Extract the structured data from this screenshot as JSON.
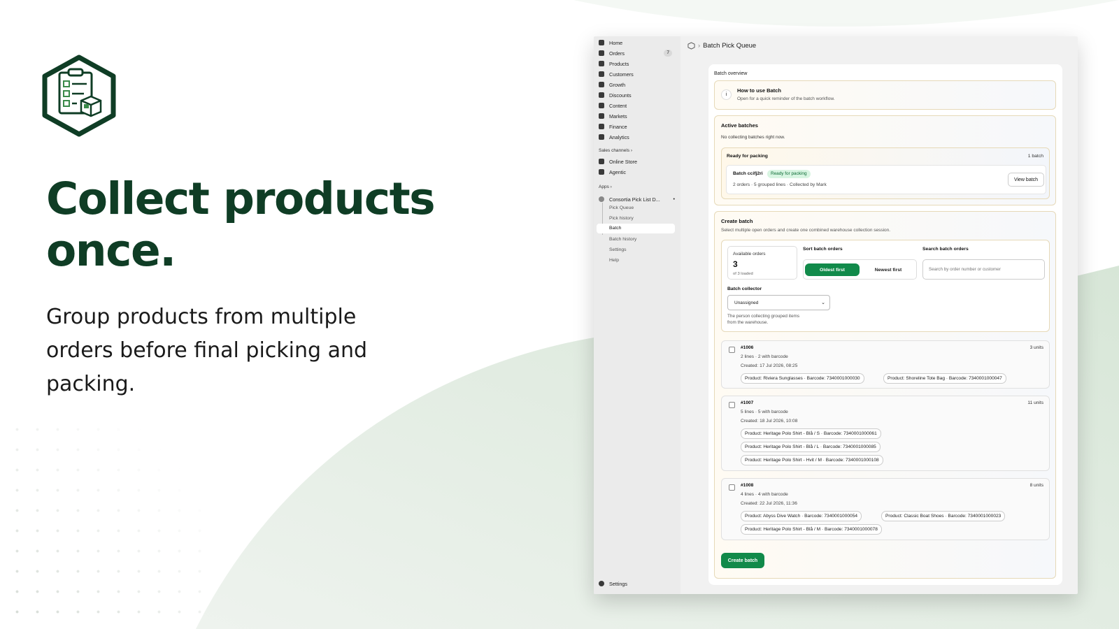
{
  "hero": {
    "title_line1": "Collect products",
    "title_line2": "once.",
    "subtitle_line1": "Group products from multiple",
    "subtitle_line2": "orders before final picking and",
    "subtitle_line3": "packing."
  },
  "colors": {
    "brand": "#0f3d25",
    "accent": "#118a4a"
  },
  "sidebar": {
    "items": [
      {
        "label": "Home",
        "icon": "home-icon"
      },
      {
        "label": "Orders",
        "icon": "orders-icon",
        "badge": "7"
      },
      {
        "label": "Products",
        "icon": "tag-icon"
      },
      {
        "label": "Customers",
        "icon": "person-icon"
      },
      {
        "label": "Growth",
        "icon": "growth-icon"
      },
      {
        "label": "Discounts",
        "icon": "discount-icon"
      },
      {
        "label": "Content",
        "icon": "content-icon"
      },
      {
        "label": "Markets",
        "icon": "globe-icon"
      },
      {
        "label": "Finance",
        "icon": "bank-icon"
      },
      {
        "label": "Analytics",
        "icon": "chart-icon"
      }
    ],
    "sales_channels_label": "Sales channels",
    "channels": [
      {
        "label": "Online Store",
        "icon": "store-icon"
      },
      {
        "label": "Agentic",
        "icon": "agentic-icon"
      }
    ],
    "apps_label": "Apps",
    "app_name": "Consortia Pick List D...",
    "app_items": [
      "Pick Queue",
      "Pick history",
      "Batch",
      "Batch history",
      "Settings",
      "Help"
    ],
    "settings_label": "Settings"
  },
  "topbar": {
    "title": "Batch Pick Queue"
  },
  "main": {
    "section_label": "Batch overview",
    "info_title": "How to use Batch",
    "info_text": "Open for a quick reminder of the batch workflow.",
    "active": {
      "title": "Active batches",
      "empty": "No collecting batches right now.",
      "group_title": "Ready for packing",
      "group_count": "1 batch",
      "batch_name": "Batch ccifj2ri",
      "batch_status": "Ready for packing",
      "batch_meta": "2 orders · 5 grouped lines · Collected by Mark",
      "view_label": "View batch"
    },
    "create": {
      "title": "Create batch",
      "desc": "Select multiple open orders and create one combined warehouse collection session.",
      "available_label": "Available orders",
      "available_count": "3",
      "available_sub": "of 3 loaded",
      "sort_label": "Sort batch orders",
      "sort_options": [
        "Oldest first",
        "Newest first"
      ],
      "search_label": "Search batch orders",
      "search_placeholder": "Search by order number or customer",
      "collector_label": "Batch collector",
      "collector_value": "Unassigned",
      "collector_help1": "The person collecting grouped items",
      "collector_help2": "from the warehouse."
    },
    "orders": [
      {
        "number": "#1006",
        "lines": "2 lines · 2 with barcode",
        "created": "Created: 17 Jul 2026, 08:25",
        "units": "3 units",
        "products": [
          "Product: Riviera Sunglasses · Barcode: 7340001000030",
          "Product: Shoreline Tote Bag · Barcode: 7340001000047"
        ]
      },
      {
        "number": "#1007",
        "lines": "5 lines · 5 with barcode",
        "created": "Created: 18 Jul 2026, 10:08",
        "units": "11 units",
        "products": [
          "Product: Heritage Polo Shirt - Blå / S · Barcode: 7340001000061",
          "Product: Heritage Polo Shirt - Blå / L · Barcode: 7340001000085",
          "Product: Heritage Polo Shirt - Hvit / M · Barcode: 7340001000108"
        ]
      },
      {
        "number": "#1008",
        "lines": "4 lines · 4 with barcode",
        "created": "Created: 22 Jul 2026, 11:36",
        "units": "8 units",
        "products": [
          "Product: Abyss Dive Watch · Barcode: 7340001000054",
          "Product: Classic Boat Shoes · Barcode: 7340001000023",
          "Product: Heritage Polo Shirt - Blå / M · Barcode: 7340001000078"
        ]
      }
    ],
    "create_button": "Create batch"
  }
}
